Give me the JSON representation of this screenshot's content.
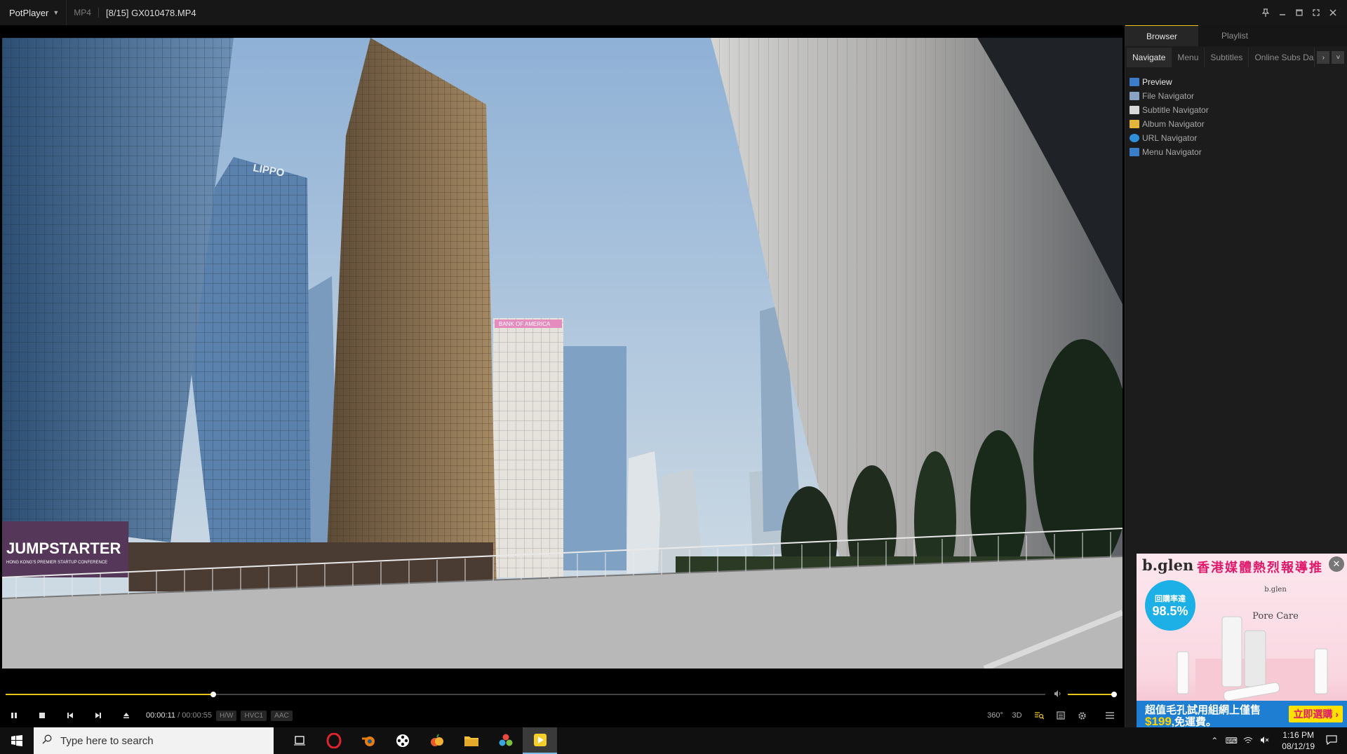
{
  "titlebar": {
    "app_name": "PotPlayer",
    "format": "MP4",
    "file_title": "[8/15] GX010478.MP4"
  },
  "video": {
    "signs": {
      "jumpstarter": "JUMPSTARTER",
      "jumpstarter_sub": "HONG KONG'S PREMIER STARTUP CONFERENCE",
      "lippo": "LIPPO",
      "bofa": "BANK OF AMERICA"
    }
  },
  "playback": {
    "progress_fraction": 0.2,
    "volume_fraction": 1.0,
    "current_time": "00:00:11",
    "separator": " / ",
    "duration": "00:00:55",
    "badges": [
      "H/W",
      "HVC1",
      "AAC"
    ],
    "right_buttons": [
      "360°",
      "3D"
    ]
  },
  "panel": {
    "tabs": [
      "Browser",
      "Playlist"
    ],
    "active_tab": 0,
    "subtabs": [
      "Navigate",
      "Menu",
      "Subtitles",
      "Online Subs Da"
    ],
    "navigator_items": [
      {
        "label": "Preview",
        "icon": "preview-icon",
        "color": "#3d7cc9"
      },
      {
        "label": "File Navigator",
        "icon": "file-icon",
        "color": "#8aa3c2"
      },
      {
        "label": "Subtitle Navigator",
        "icon": "subtitle-icon",
        "color": "#d8d8d8"
      },
      {
        "label": "Album Navigator",
        "icon": "album-icon",
        "color": "#e3b53a"
      },
      {
        "label": "URL Navigator",
        "icon": "ie-icon",
        "color": "#2f8fd8"
      },
      {
        "label": "Menu Navigator",
        "icon": "menu-icon",
        "color": "#3a7dc9"
      }
    ]
  },
  "ad": {
    "brand": "b.glen",
    "headline": "香港媒體熱烈報導推",
    "badge_top": "回購率達",
    "badge_value": "98.5%",
    "product_brand": "b.glen",
    "product_name": "Pore Care",
    "line1": "超值毛孔試用組網上僅售",
    "price": "$199",
    "line2_rest": ",免運費。",
    "cta": "立即選購",
    "close": "✕"
  },
  "taskbar": {
    "search_placeholder": "Type here to search",
    "time": "1:16 PM",
    "date": "08/12/19"
  },
  "colors": {
    "accent": "#e9c319",
    "background": "#141414",
    "panel": "#1c1c1c"
  }
}
